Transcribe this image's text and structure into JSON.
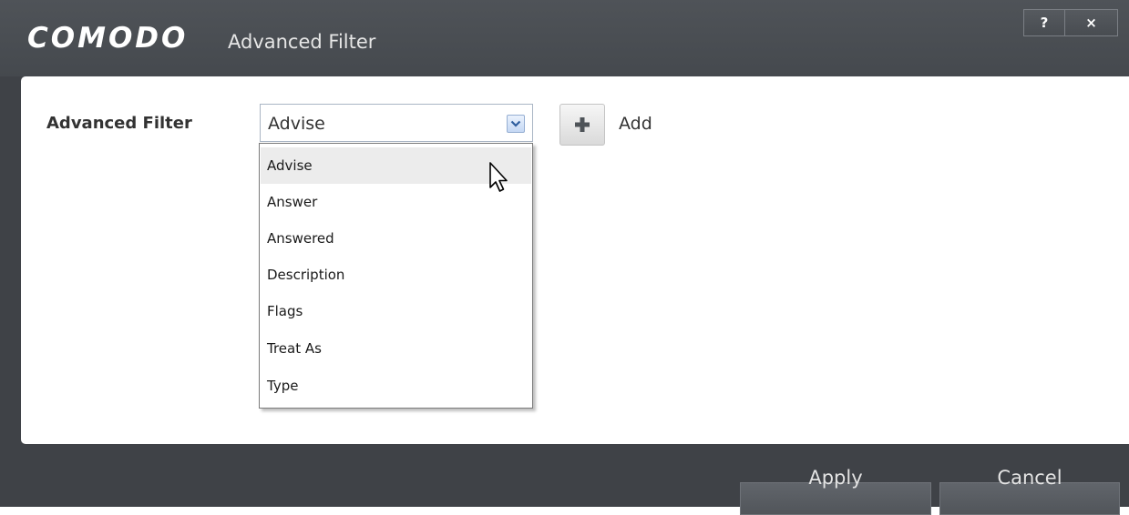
{
  "titlebar": {
    "brand": "COMODO",
    "title": "Advanced Filter",
    "help_label": "?",
    "close_label": "×"
  },
  "form": {
    "filter_label": "Advanced Filter",
    "selected_value": "Advise",
    "add_label": "Add"
  },
  "dropdown": {
    "options": [
      "Advise",
      "Answer",
      "Answered",
      "Description",
      "Flags",
      "Treat As",
      "Type"
    ],
    "highlighted": "Advise"
  },
  "footer": {
    "apply_label": "Apply",
    "cancel_label": "Cancel"
  },
  "colors": {
    "titlebar": "#4a4e53",
    "panel": "#ffffff",
    "combo_border": "#a9b5c4",
    "highlight": "#ececec",
    "add_icon": "#4e5358"
  }
}
